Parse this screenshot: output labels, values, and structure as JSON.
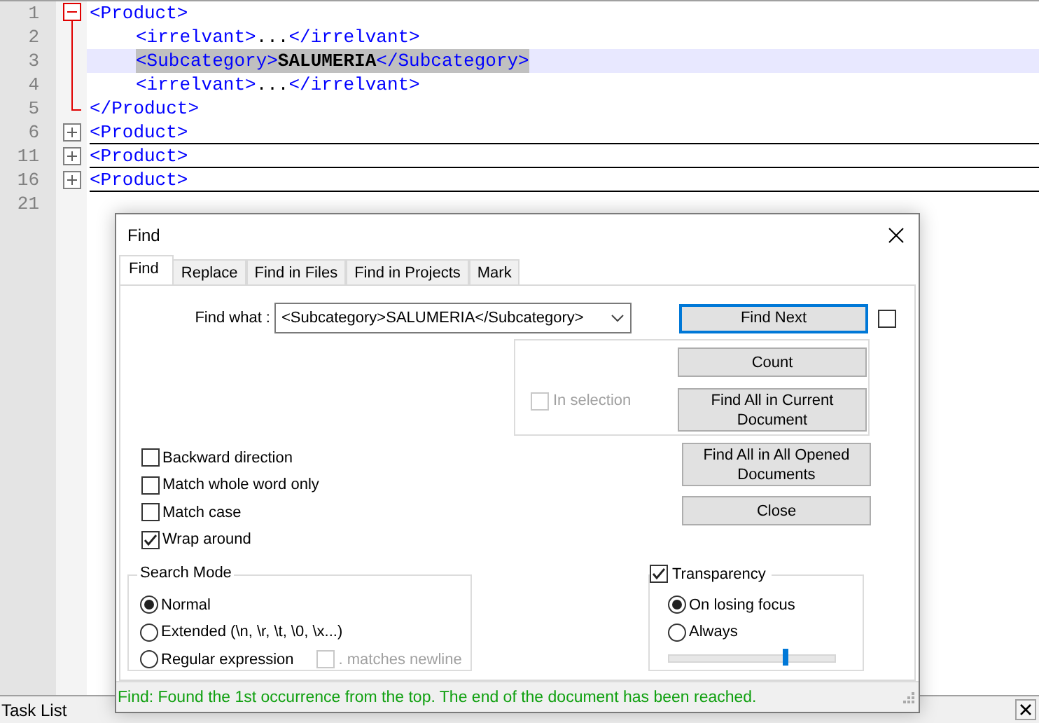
{
  "editor": {
    "lines": [
      {
        "number": "1",
        "expanded": true,
        "segments": [
          {
            "kind": "tag",
            "text": "<Product>"
          }
        ],
        "children": [
          {
            "number": "2",
            "segments": [
              {
                "kind": "tag",
                "text": "<irrelvant>"
              },
              {
                "kind": "text",
                "text": "..."
              },
              {
                "kind": "tag",
                "text": "</irrelvant>"
              }
            ]
          },
          {
            "number": "3",
            "selected": true,
            "segments": [
              {
                "kind": "tag",
                "text": "<Subcategory>"
              },
              {
                "kind": "bold",
                "text": "SALUMERIA"
              },
              {
                "kind": "tag",
                "text": "</Subcategory>"
              }
            ]
          },
          {
            "number": "4",
            "segments": [
              {
                "kind": "tag",
                "text": "<irrelvant>"
              },
              {
                "kind": "text",
                "text": "..."
              },
              {
                "kind": "tag",
                "text": "</irrelvant>"
              }
            ]
          }
        ],
        "closing": {
          "number": "5",
          "segments": [
            {
              "kind": "tag",
              "text": "</Product>"
            }
          ]
        }
      },
      {
        "number": "6",
        "expanded": false,
        "segments": [
          {
            "kind": "tag",
            "text": "<Product>"
          }
        ]
      },
      {
        "number": "11",
        "expanded": false,
        "segments": [
          {
            "kind": "tag",
            "text": "<Product>"
          }
        ]
      },
      {
        "number": "16",
        "expanded": false,
        "segments": [
          {
            "kind": "tag",
            "text": "<Product>"
          }
        ]
      },
      {
        "number": "21"
      }
    ]
  },
  "panel": {
    "title": "Task List"
  },
  "dialog": {
    "title": "Find",
    "tabs": [
      {
        "label": "Find",
        "selected": true
      },
      {
        "label": "Replace",
        "selected": false
      },
      {
        "label": "Find in Files",
        "selected": false
      },
      {
        "label": "Find in Projects",
        "selected": false
      },
      {
        "label": "Mark",
        "selected": false
      }
    ],
    "find_what": {
      "label": "Find what :",
      "value": "<Subcategory>SALUMERIA</Subcategory>"
    },
    "side_checkbox": {
      "checked": false
    },
    "in_selection": {
      "label": "In selection",
      "checked": false,
      "disabled": true
    },
    "buttons": [
      {
        "label": "Find Next",
        "focused": true
      },
      {
        "label": "Count",
        "focused": false
      },
      {
        "label": "Find All in Current Document",
        "focused": false
      },
      {
        "label": "Find All in All Opened Documents",
        "focused": false
      },
      {
        "label": "Close",
        "focused": false
      }
    ],
    "options": [
      {
        "label": "Backward direction",
        "checked": false
      },
      {
        "label": "Match whole word only",
        "checked": false
      },
      {
        "label": "Match case",
        "checked": false
      },
      {
        "label": "Wrap around",
        "checked": true
      }
    ],
    "search_mode": {
      "title": "Search Mode",
      "options": [
        {
          "label": "Normal",
          "selected": true
        },
        {
          "label": "Extended (\\n, \\r, \\t, \\0, \\x...)",
          "selected": false
        },
        {
          "label": "Regular expression",
          "selected": false
        }
      ],
      "matches_newline": {
        "label": ". matches newline",
        "checked": false,
        "disabled": true
      }
    },
    "transparency": {
      "label": "Transparency",
      "checked": true,
      "options": [
        {
          "label": "On losing focus",
          "selected": true
        },
        {
          "label": "Always",
          "selected": false
        }
      ],
      "level": 0.7
    },
    "status": "Find: Found the 1st occurrence from the top. The end of the document has been reached."
  }
}
